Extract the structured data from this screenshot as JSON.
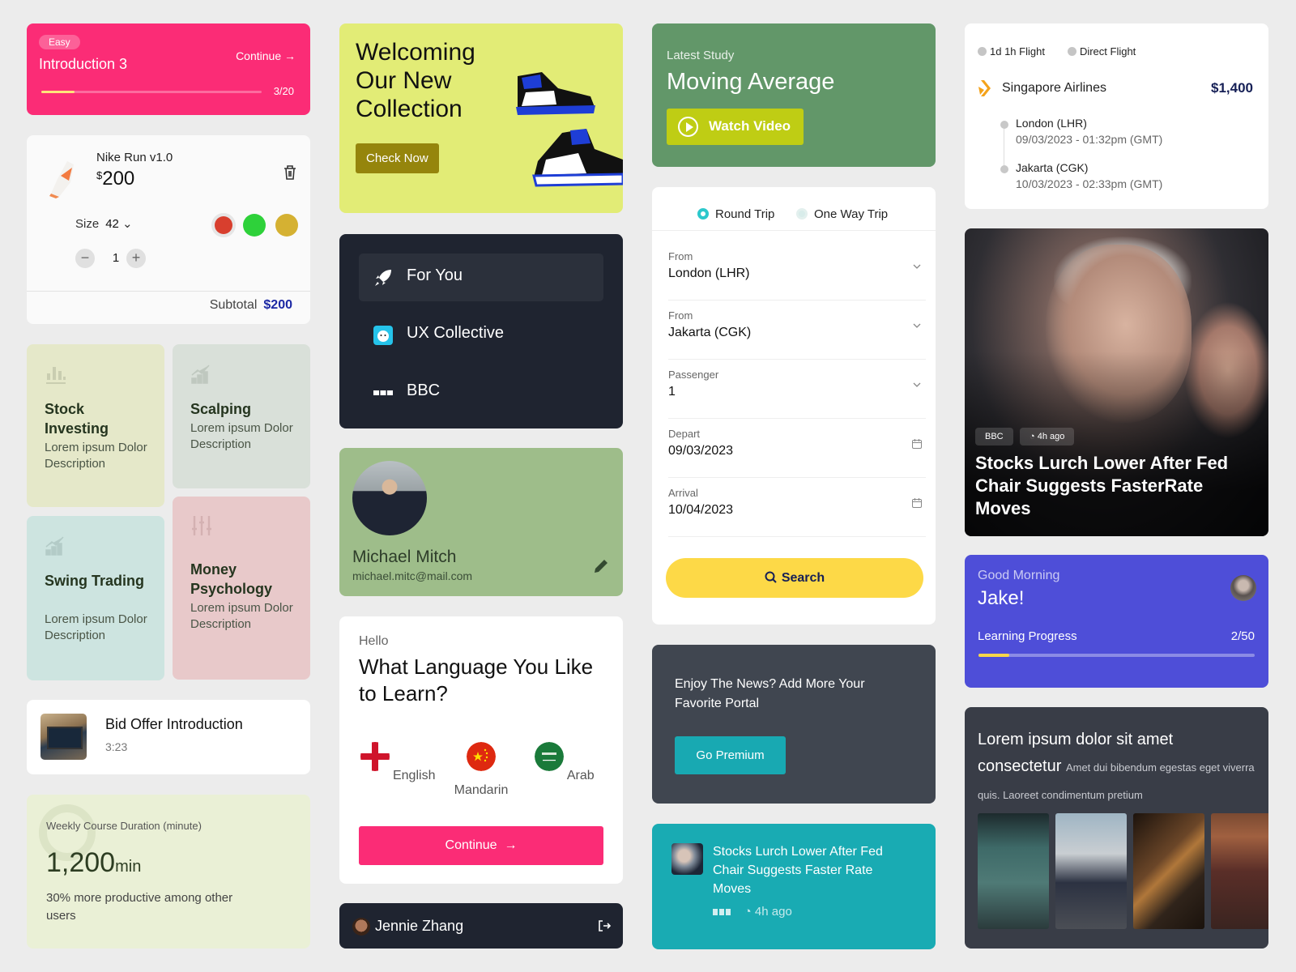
{
  "lesson_card": {
    "badge": "Easy",
    "title": "Introduction 3",
    "continue_label": "Continue →",
    "progress": {
      "current": 3,
      "total": 20,
      "label": "3/20"
    }
  },
  "cart_item": {
    "name": "Nike Run v1.0",
    "currency": "$",
    "price": "200",
    "size_label": "Size",
    "size_value": "42",
    "colors": [
      "#d83f2e",
      "#2ed13a",
      "#d5b132"
    ],
    "selected_color": "#d83f2e",
    "quantity": "1",
    "subtotal_label": "Subtotal",
    "subtotal_value": "$200"
  },
  "topics": [
    {
      "title": "Stock Investing",
      "description": "Lorem ipsum Dolor Description",
      "icon": "bar-chart-icon",
      "color": "#e5e8c9"
    },
    {
      "title": "Scalping",
      "description": "Lorem ipsum Dolor Description",
      "icon": "growth-chart-icon",
      "color": "#d9e0d9"
    },
    {
      "title": "Swing Trading",
      "description": "Lorem ipsum Dolor Description",
      "icon": "growth-chart-icon",
      "color": "#cde4e0"
    },
    {
      "title": "Money Psychology",
      "description": "Lorem ipsum Dolor Description",
      "icon": "sliders-icon",
      "color": "#e8c9ca"
    }
  ],
  "video_item": {
    "title": "Bid Offer Introduction",
    "duration": "3:23"
  },
  "weekly": {
    "label": "Weekly Course Duration (minute)",
    "value": "1,200",
    "unit": "min",
    "note": "30% more productive among other users"
  },
  "collection": {
    "headline": "Welcoming Our New Collection",
    "button": "Check Now"
  },
  "portals": {
    "items": [
      {
        "label": "For You",
        "icon": "rocket-icon",
        "active": true
      },
      {
        "label": "UX Collective",
        "icon": "ux-collective-logo"
      },
      {
        "label": "BBC",
        "icon": "bbc-logo"
      }
    ]
  },
  "profile": {
    "name": "Michael Mitch",
    "email": "michael.mitc@mail.com"
  },
  "language": {
    "greeting": "Hello",
    "question": "What Language You Like to Learn?",
    "options": [
      {
        "label": "English",
        "flag": "england-flag"
      },
      {
        "label": "Mandarin",
        "flag": "china-flag"
      },
      {
        "label": "Arab",
        "flag": "saudi-flag"
      }
    ],
    "button": "Continue"
  },
  "user_bar": {
    "name": "Jennie Zhang"
  },
  "study": {
    "label": "Latest Study",
    "title": "Moving Average",
    "button": "Watch Video"
  },
  "flight_form": {
    "trip_types": [
      {
        "label": "Round Trip",
        "selected": true
      },
      {
        "label": "One Way Trip",
        "selected": false
      }
    ],
    "fields": [
      {
        "label": "From",
        "value": "London (LHR)",
        "icon": "chevron-down"
      },
      {
        "label": "From",
        "value": "Jakarta (CGK)",
        "icon": "chevron-down"
      },
      {
        "label": "Passenger",
        "value": "1",
        "icon": "chevron-down"
      },
      {
        "label": "Depart",
        "value": "09/03/2023",
        "icon": "calendar"
      },
      {
        "label": "Arrival",
        "value": "10/04/2023",
        "icon": "calendar"
      }
    ],
    "search_button": "Search"
  },
  "premium": {
    "text": "Enjoy The News? Add More Your Favorite Portal",
    "button": "Go Premium"
  },
  "news_small": {
    "title": "Stocks Lurch Lower After Fed Chair Suggests Faster Rate Moves",
    "source": "BBC",
    "time": "4h ago"
  },
  "itinerary": {
    "duration": "1d 1h Flight",
    "type": "Direct Flight",
    "airline": "Singapore Airlines",
    "price": "$1,400",
    "stops": [
      {
        "city": "London (LHR)",
        "time": "09/03/2023 - 01:32pm (GMT)"
      },
      {
        "city": "Jakarta (CGK)",
        "time": "10/03/2023 - 02:33pm (GMT)"
      }
    ]
  },
  "hero_news": {
    "source": "BBC",
    "time": "4h ago",
    "title": "Stocks Lurch Lower After Fed Chair Suggests FasterRate Moves"
  },
  "greeting": {
    "salutation": "Good Morning",
    "name": "Jake!",
    "progress_label": "Learning Progress",
    "progress": {
      "current": 2,
      "total": 50,
      "label": "2/50"
    }
  },
  "gallery": {
    "title": "Lorem ipsum dolor sit amet consectetur",
    "subtitle": "Amet dui bibendum egestas eget viverra quis. Laoreet condimentum pretium",
    "photos": [
      "parliament-chamber",
      "meeting-room",
      "desk-rows",
      "assembly-hall"
    ]
  }
}
